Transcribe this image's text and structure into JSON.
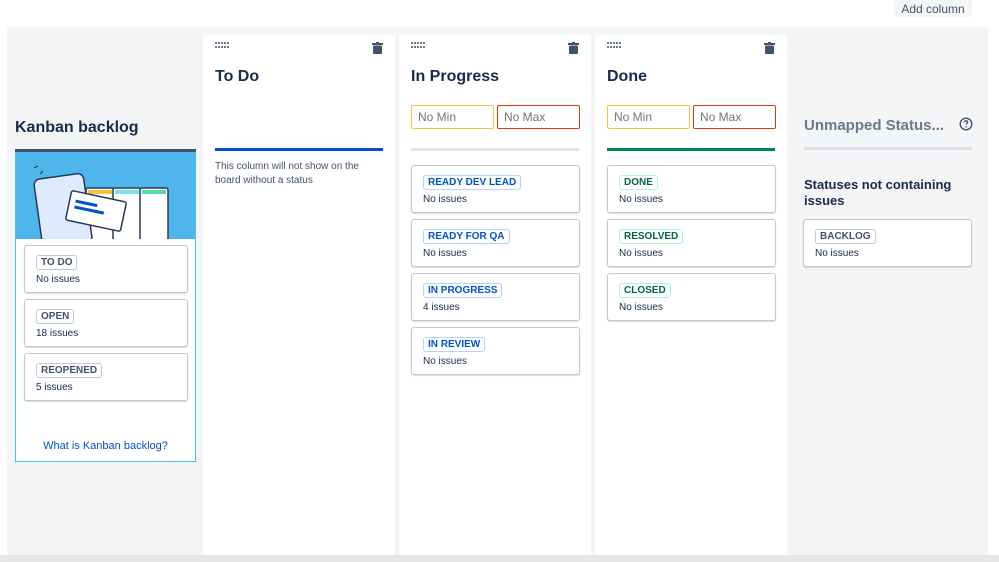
{
  "header": {
    "add_column_label": "Add column"
  },
  "backlog": {
    "title": "Kanban backlog",
    "help_link": "What is Kanban backlog?",
    "statuses": [
      {
        "label": "TO DO",
        "count": "No issues"
      },
      {
        "label": "OPEN",
        "count": "18 issues"
      },
      {
        "label": "REOPENED",
        "count": "5 issues"
      }
    ]
  },
  "columns": [
    {
      "title": "To Do",
      "note": "This column will not show on the board without a status",
      "statuses": []
    },
    {
      "title": "In Progress",
      "min_label": "No Min",
      "max_label": "No Max",
      "statuses": [
        {
          "label": "READY DEV LEAD",
          "count": "No issues"
        },
        {
          "label": "READY FOR QA",
          "count": "No issues"
        },
        {
          "label": "IN PROGRESS",
          "count": "4 issues"
        },
        {
          "label": "IN REVIEW",
          "count": "No issues"
        }
      ]
    },
    {
      "title": "Done",
      "min_label": "No Min",
      "max_label": "No Max",
      "statuses": [
        {
          "label": "DONE",
          "count": "No issues"
        },
        {
          "label": "RESOLVED",
          "count": "No issues"
        },
        {
          "label": "CLOSED",
          "count": "No issues"
        }
      ]
    }
  ],
  "unmapped": {
    "title": "Unmapped Status...",
    "subtitle": "Statuses not containing issues",
    "statuses": [
      {
        "label": "BACKLOG",
        "count": "No issues"
      }
    ]
  },
  "colors": {
    "todo_bar": "#0052cc",
    "inprogress_bar": "#dfe1e6",
    "done_bar": "#00875a",
    "min_border": "#f5c442",
    "max_border": "#de350b"
  },
  "icons": [
    "drag-handle-icon",
    "trash-icon",
    "question-circle-icon",
    "kanban-illustration"
  ]
}
